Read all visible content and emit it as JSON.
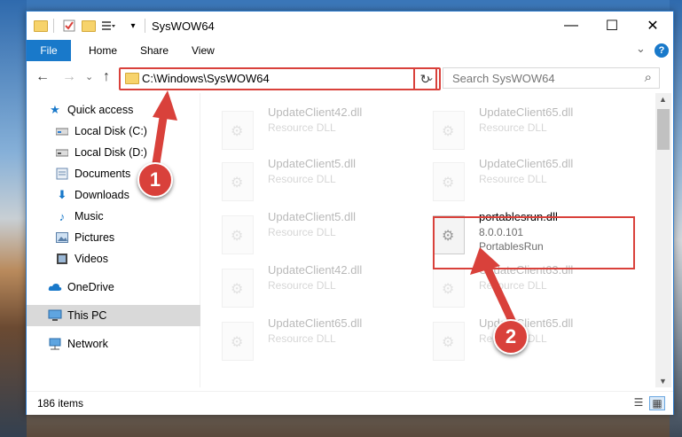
{
  "window": {
    "title": "SysWOW64",
    "controls": {
      "minimize": "—",
      "maximize": "☐",
      "close": "✕"
    }
  },
  "ribbon": {
    "tabs": [
      "File",
      "Home",
      "Share",
      "View"
    ],
    "collapse_icon": "⌄",
    "help_icon": "?"
  },
  "navigation": {
    "back": "←",
    "forward": "→",
    "recent": "⌄",
    "up": "↑",
    "address": "C:\\Windows\\SysWOW64",
    "dropdown": "⌄",
    "refresh": "↻",
    "search_placeholder": "Search SysWOW64",
    "search_icon": "⌕"
  },
  "sidebar": {
    "items": [
      {
        "label": "Quick access",
        "icon": "star-icon"
      },
      {
        "label": "Local Disk (C:)",
        "icon": "drive-icon",
        "pinned": true
      },
      {
        "label": "Local Disk (D:)",
        "icon": "drive-icon",
        "pinned": true
      },
      {
        "label": "Documents",
        "icon": "documents-icon",
        "pinned": true
      },
      {
        "label": "Downloads",
        "icon": "downloads-icon",
        "pinned": true
      },
      {
        "label": "Music",
        "icon": "music-icon",
        "pinned": true
      },
      {
        "label": "Pictures",
        "icon": "pictures-icon",
        "pinned": true
      },
      {
        "label": "Videos",
        "icon": "videos-icon",
        "pinned": true
      },
      {
        "label": "OneDrive",
        "icon": "cloud-icon"
      },
      {
        "label": "This PC",
        "icon": "computer-icon",
        "selected": true
      },
      {
        "label": "Network",
        "icon": "network-icon"
      }
    ]
  },
  "files": [
    {
      "name": "UpdateClient42.dll",
      "type": "Resource DLL"
    },
    {
      "name": "UpdateClient65.dll",
      "type": "Resource DLL"
    },
    {
      "name": "UpdateClient5.dll",
      "type": "Resource DLL"
    },
    {
      "name": "UpdateClient65.dll",
      "type": "Resource DLL"
    },
    {
      "name": "UpdateClient5.dll",
      "type": "Resource DLL"
    },
    {
      "name": "portablesrun.dll",
      "version": "8.0.0.101",
      "product": "PortablesRun"
    },
    {
      "name": "UpdateClient42.dll",
      "type": "Resource DLL"
    },
    {
      "name": "UpdateClient63.dll",
      "type": "Resource DLL"
    },
    {
      "name": "UpdateClient65.dll",
      "type": "Resource DLL"
    },
    {
      "name": "UpdateClient65.dll",
      "type": "Resource DLL"
    }
  ],
  "status": {
    "item_count": "186 items"
  },
  "annotations": {
    "step1": "1",
    "step2": "2",
    "accent_color": "#d9413b"
  }
}
